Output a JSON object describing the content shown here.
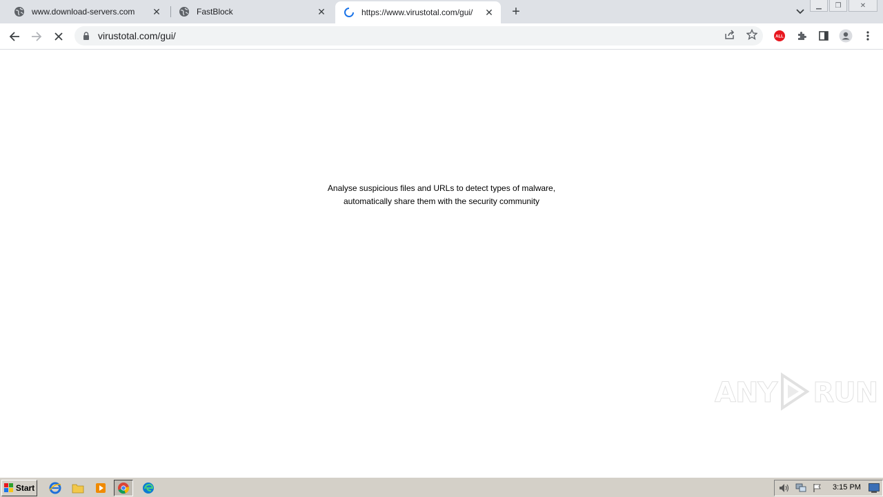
{
  "tabs": [
    {
      "title": "www.download-servers.com",
      "icon": "globe-icon"
    },
    {
      "title": "FastBlock",
      "icon": "globe-icon"
    },
    {
      "title": "https://www.virustotal.com/gui/",
      "icon": "loading-spinner-icon",
      "active": true
    }
  ],
  "omnibox": {
    "url": "virustotal.com/gui/"
  },
  "page": {
    "tagline_line1": "Analyse suspicious files and URLs to detect types of malware,",
    "tagline_line2": "automatically share them with the security community"
  },
  "watermark": {
    "text_left": "ANY",
    "text_right": "RUN"
  },
  "taskbar": {
    "start_label": "Start",
    "clock": "3:15 PM"
  },
  "colors": {
    "tabstrip": "#dee1e6",
    "extension_red": "#e8171f",
    "spinner_blue": "#1a73e8"
  }
}
